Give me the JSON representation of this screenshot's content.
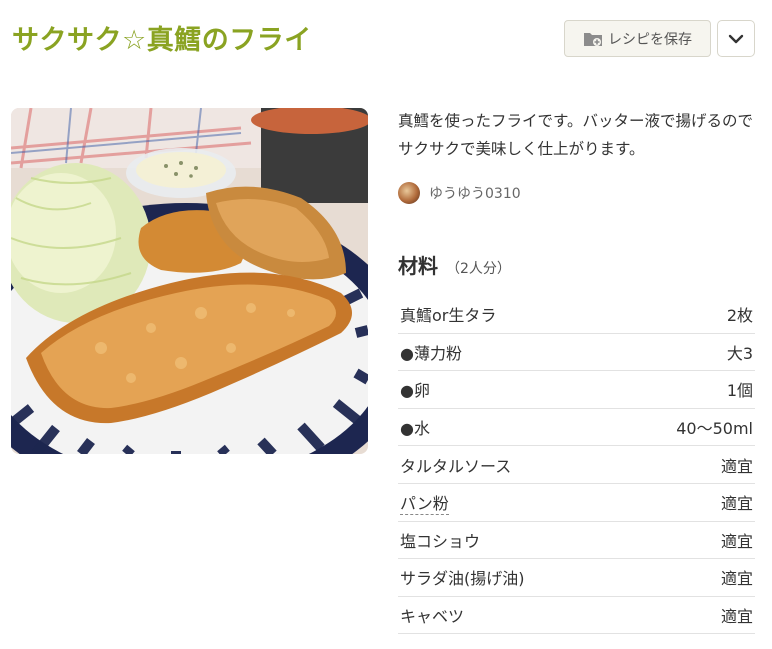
{
  "recipe": {
    "title": "サクサク☆真鱈のフライ",
    "description": "真鱈を使ったフライです。バッター液で揚げるのでサクサクで美味しく仕上がります。",
    "author": "ゆうゆう0310"
  },
  "actions": {
    "save_label": "レシピを保存",
    "save_icon": "folder-plus-icon",
    "more_icon": "chevron-down-icon"
  },
  "ingredients": {
    "title": "材料",
    "serving": "（2人分）",
    "items": [
      {
        "name": "真鱈or生タラ",
        "qty": "2枚"
      },
      {
        "name": "●薄力粉",
        "qty": "大3"
      },
      {
        "name": "●卵",
        "qty": "1個"
      },
      {
        "name": "●水",
        "qty": "40～50ml"
      },
      {
        "name": "タルタルソース",
        "qty": "適宜"
      },
      {
        "name": "パン粉",
        "qty": "適宜"
      },
      {
        "name": "塩コショウ",
        "qty": "適宜"
      },
      {
        "name": "サラダ油(揚げ油)",
        "qty": "適宜"
      },
      {
        "name": "キャベツ",
        "qty": "適宜"
      }
    ]
  },
  "colors": {
    "title": "#8aa322",
    "button_bg": "#f6f5ef"
  }
}
